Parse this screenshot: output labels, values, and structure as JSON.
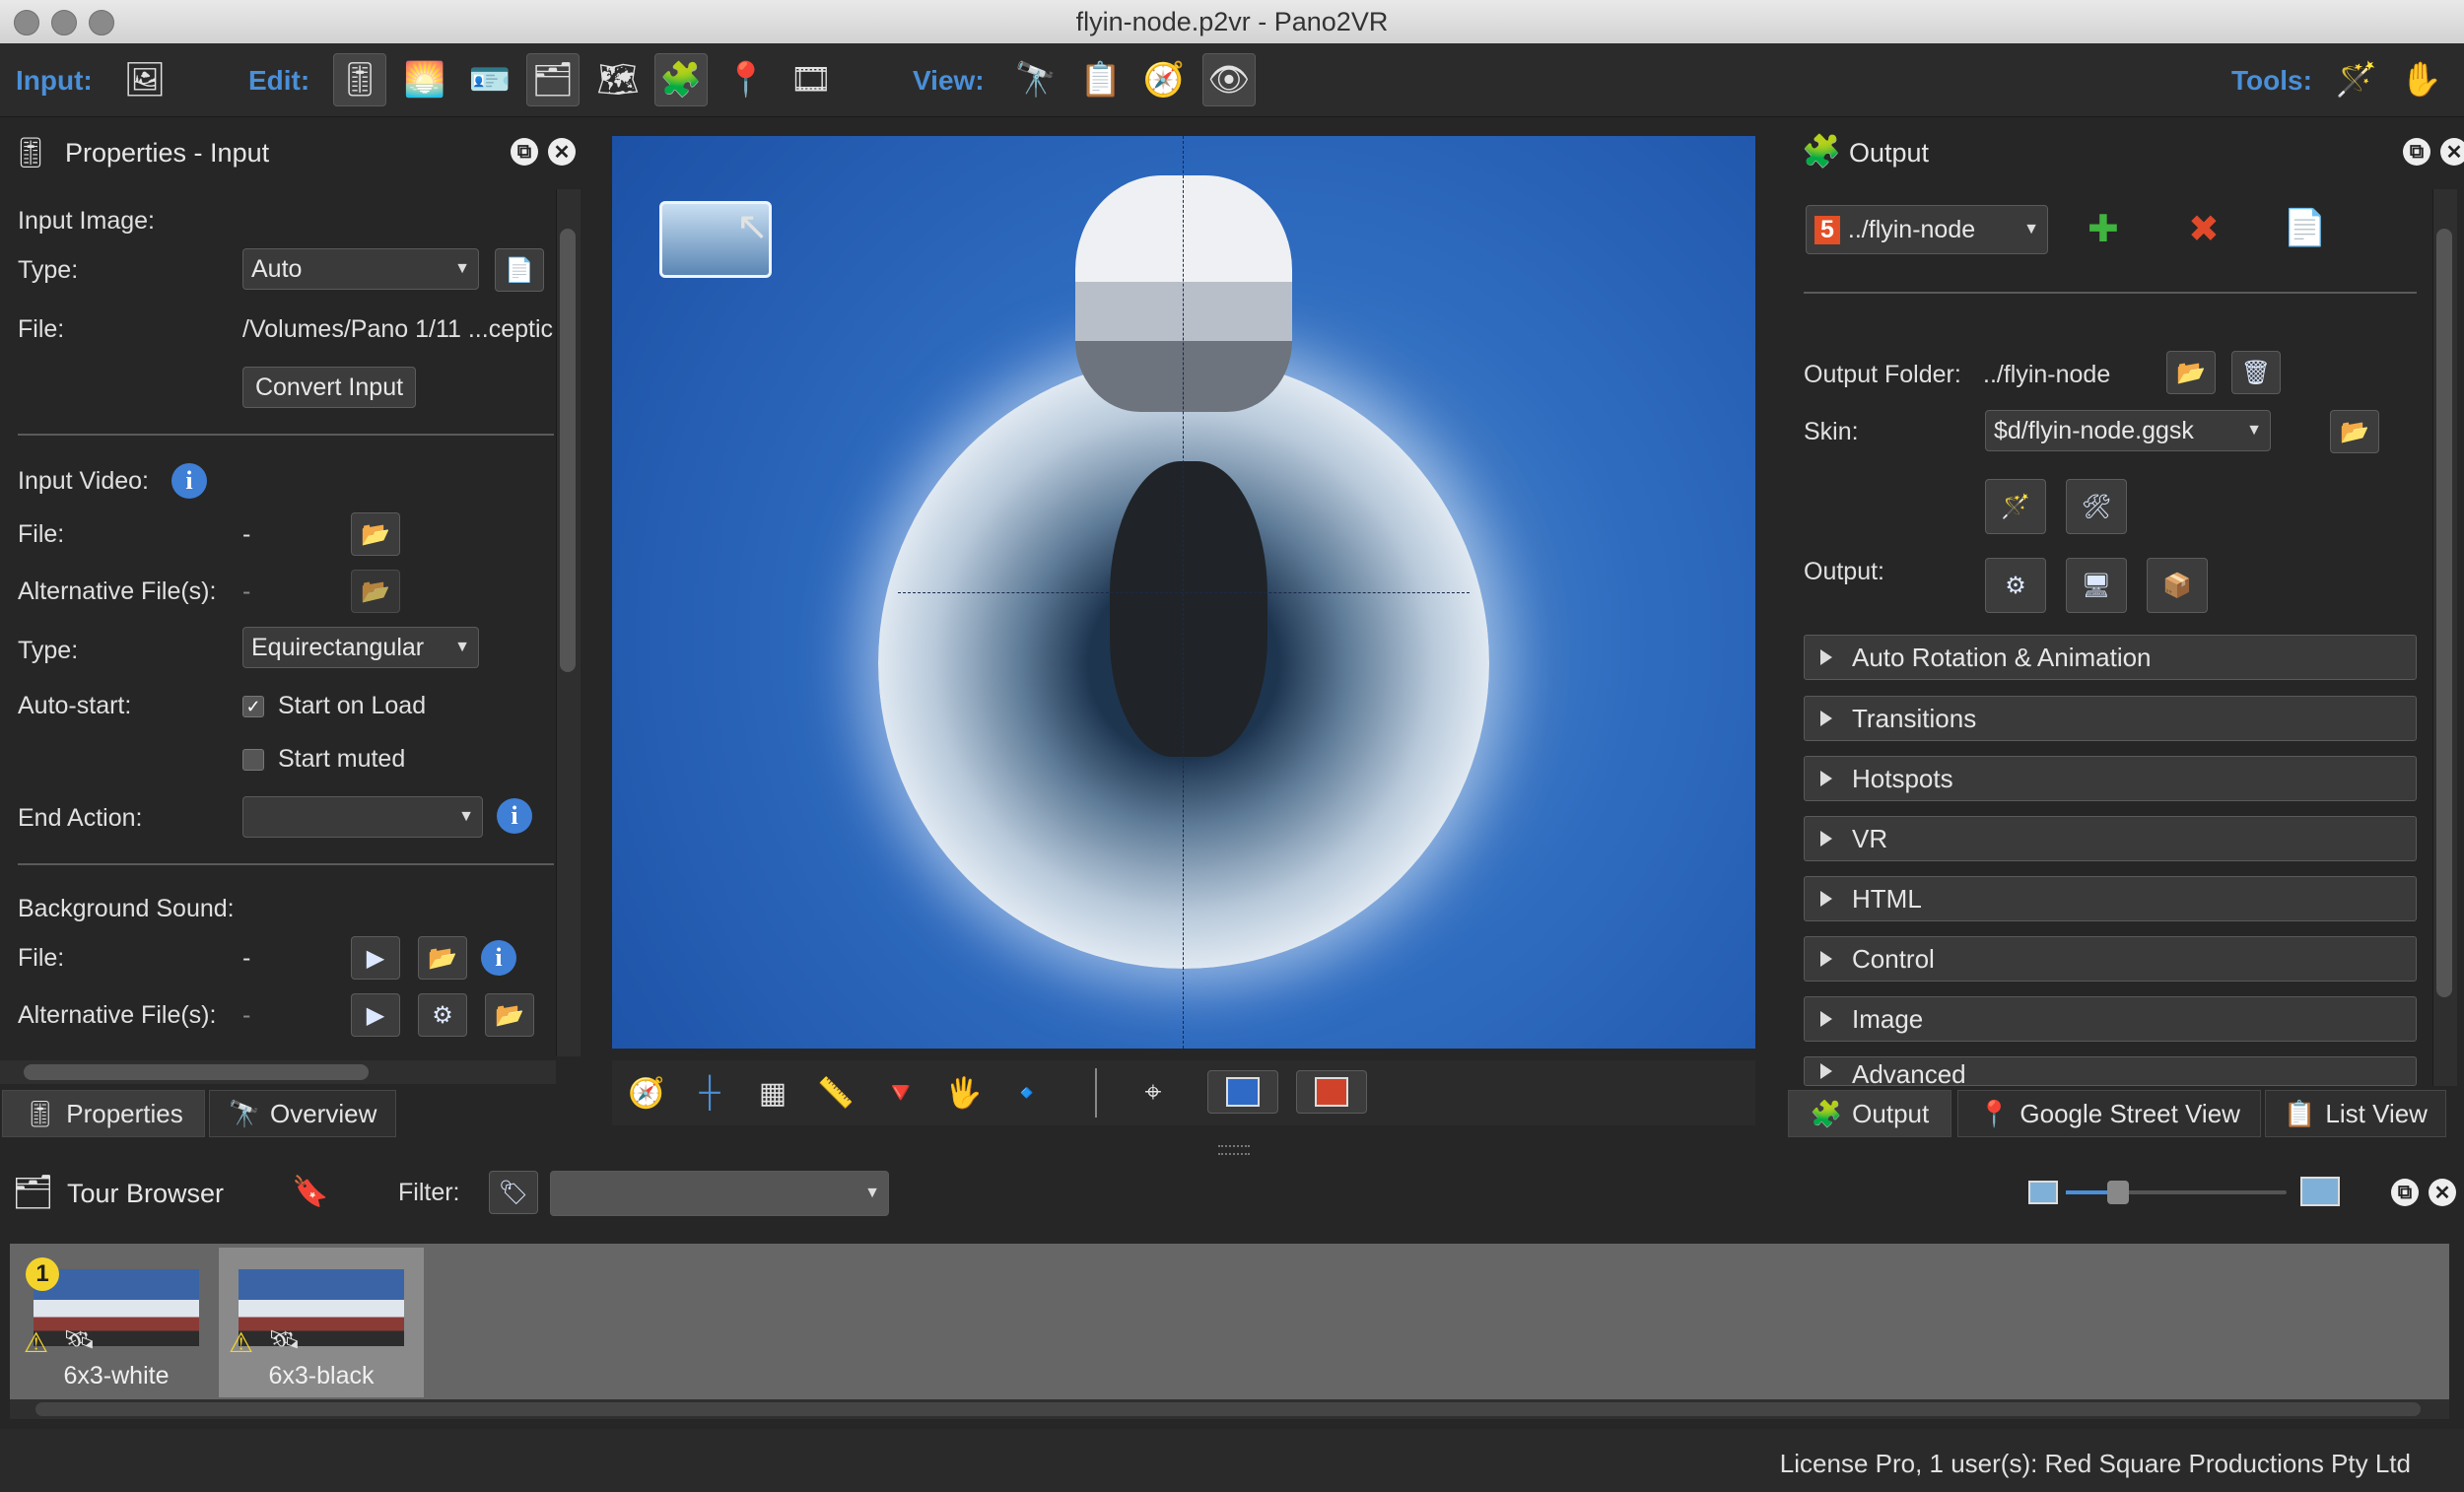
{
  "window": {
    "title": "flyin-node.p2vr - Pano2VR"
  },
  "toolbar": {
    "input_label": "Input:",
    "edit_label": "Edit:",
    "view_label": "View:",
    "tools_label": "Tools:"
  },
  "properties": {
    "title": "Properties - Input",
    "input_image_label": "Input Image:",
    "type_label": "Type:",
    "type_value": "Auto",
    "file_label": "File:",
    "file_value": "/Volumes/Pano 1/11 ...ceptic",
    "convert_button": "Convert Input",
    "input_video_label": "Input Video:",
    "video_file_label": "File:",
    "video_file_value": "-",
    "alt_files_label": "Alternative File(s):",
    "alt_files_value": "-",
    "video_type_label": "Type:",
    "video_type_value": "Equirectangular",
    "autostart_label": "Auto-start:",
    "start_on_load_label": "Start on Load",
    "start_muted_label": "Start muted",
    "end_action_label": "End Action:",
    "end_action_value": "",
    "bg_sound_label": "Background Sound:",
    "sound_file_label": "File:",
    "sound_file_value": "-",
    "sound_alt_label": "Alternative File(s):",
    "sound_alt_value": "-"
  },
  "left_tabs": {
    "properties": "Properties",
    "overview": "Overview"
  },
  "output": {
    "title": "Output",
    "format_value": "../flyin-node",
    "output_folder_label": "Output Folder:",
    "output_folder_value": "../flyin-node",
    "skin_label": "Skin:",
    "skin_value": "$d/flyin-node.ggsk",
    "output_label": "Output:",
    "sections": [
      "Auto Rotation & Animation",
      "Transitions",
      "Hotspots",
      "VR",
      "HTML",
      "Control",
      "Image",
      "Advanced"
    ]
  },
  "right_tabs": {
    "output": "Output",
    "street_view": "Google Street View",
    "list_view": "List View"
  },
  "tour_browser": {
    "title": "Tour Browser",
    "filter_label": "Filter:",
    "filter_value": "",
    "badge_number": "1",
    "thumbnails": [
      "6x3-white",
      "6x3-black"
    ]
  },
  "status": {
    "license": "License Pro, 1 user(s): Red Square Productions Pty Ltd"
  }
}
